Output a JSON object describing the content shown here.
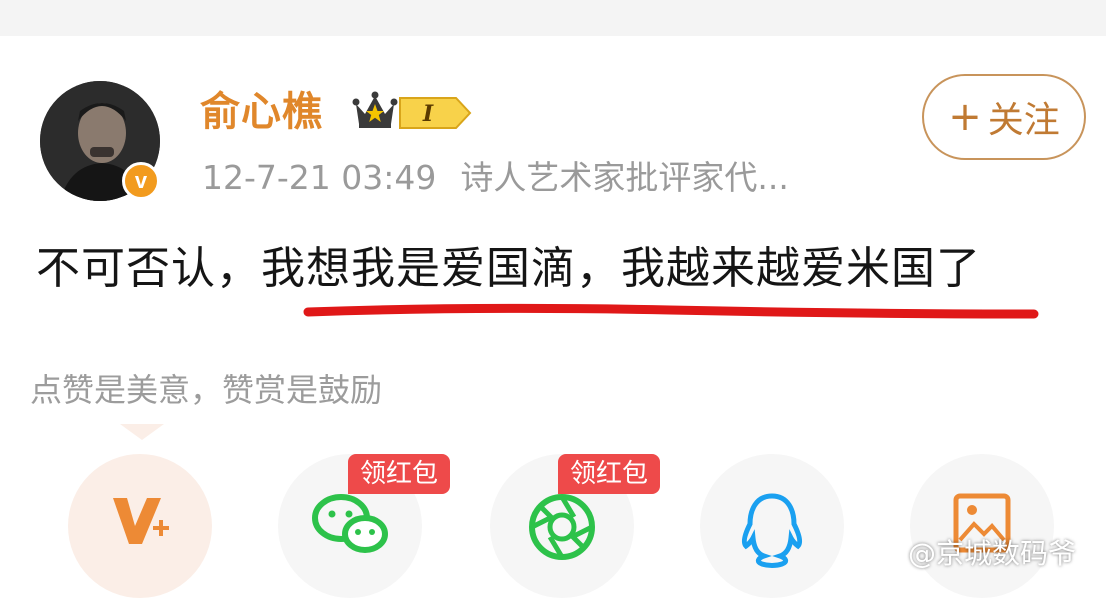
{
  "post": {
    "author": {
      "name": "俞心樵",
      "level_badge": "I"
    },
    "time": "12-7-21 03:49",
    "bio": "诗人艺术家批评家代...",
    "follow_label": "关注",
    "content": "不可否认，我想我是爱国滴，我越来越爱米国了"
  },
  "reward": {
    "hint": "点赞是美意，赞赏是鼓励",
    "options": [
      {
        "icon": "vip-v-plus-icon",
        "tag": ""
      },
      {
        "icon": "wechat-icon",
        "tag": "领红包"
      },
      {
        "icon": "moments-icon",
        "tag": "领红包"
      },
      {
        "icon": "qq-icon",
        "tag": ""
      },
      {
        "icon": "image-icon",
        "tag": ""
      }
    ]
  },
  "watermark": "@京城数码爷",
  "colors": {
    "username": "#e0872b",
    "follow_border": "#c8945b",
    "underline": "#e01818",
    "red_tag": "#ee4a4a",
    "wechat_green": "#2dc24a",
    "qq_blue": "#1aa0f0"
  }
}
